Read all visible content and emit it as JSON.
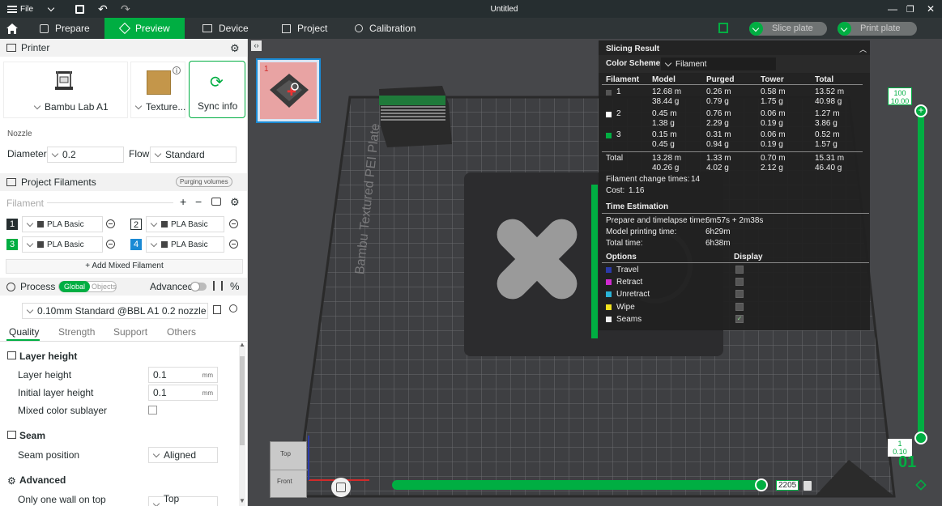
{
  "titlebar": {
    "file_menu": "File",
    "title": "Untitled"
  },
  "nav": {
    "tabs": [
      "Prepare",
      "Preview",
      "Device",
      "Project",
      "Calibration"
    ],
    "slice_plate": "Slice plate",
    "print_plate": "Print plate"
  },
  "printer": {
    "section_title": "Printer",
    "printer_name": "Bambu Lab A1",
    "plate_label": "Texture...",
    "sync_info": "Sync info",
    "nozzle_label": "Nozzle",
    "diameter_label": "Diameter",
    "diameter_value": "0.2",
    "flow_label": "Flow",
    "flow_value": "Standard"
  },
  "filaments": {
    "section_title": "Project Filaments",
    "purging_volumes": "Purging volumes",
    "filament_label": "Filament",
    "add_mixed": "+ Add Mixed Filament",
    "items": [
      {
        "num": "1",
        "name": "PLA Basic",
        "color": "#262e30"
      },
      {
        "num": "2",
        "name": "PLA Basic",
        "color": "#ffffff"
      },
      {
        "num": "3",
        "name": "PLA Basic",
        "color": "#00ae42"
      },
      {
        "num": "4",
        "name": "PLA Basic",
        "color": "#1a8ad4"
      }
    ]
  },
  "process": {
    "section_title": "Process",
    "global": "Global",
    "objects": "Objects",
    "advanced": "Advanced",
    "preset": "0.10mm Standard @BBL A1 0.2 nozzle",
    "tabs": [
      "Quality",
      "Strength",
      "Support",
      "Others"
    ],
    "layer_height_group": "Layer height",
    "layer_height_label": "Layer height",
    "layer_height_value": "0.1",
    "layer_height_unit": "mm",
    "initial_layer_label": "Initial layer height",
    "initial_layer_value": "0.1",
    "initial_layer_unit": "mm",
    "mixed_color_label": "Mixed color sublayer",
    "seam_group": "Seam",
    "seam_position_label": "Seam position",
    "seam_position_value": "Aligned",
    "advanced_group": "Advanced",
    "one_wall_label": "Only one wall on top",
    "one_wall_value": "Top surfaces"
  },
  "plate_thumb": {
    "number": "1"
  },
  "bed": {
    "text": "Bambu Textured PEI Plate"
  },
  "cube": {
    "top": "Top",
    "front": "Front"
  },
  "sliders": {
    "top_value_1": "100",
    "top_value_2": "10.00",
    "bottom_value_1": "1",
    "bottom_value_2": "0.10",
    "layer_big": "01",
    "horizontal_value": "2205"
  },
  "slicing_result": {
    "title": "Slicing Result",
    "color_scheme_label": "Color Scheme",
    "color_scheme_value": "Filament",
    "headers": [
      "Filament",
      "Model",
      "Purged",
      "Tower",
      "Total"
    ],
    "rows": [
      {
        "id": "1",
        "color": "#262e30",
        "model_m": "12.68 m",
        "model_g": "38.44 g",
        "purged_m": "0.26 m",
        "purged_g": "0.79 g",
        "tower_m": "0.58 m",
        "tower_g": "1.75 g",
        "total_m": "13.52 m",
        "total_g": "40.98 g"
      },
      {
        "id": "2",
        "color": "#ffffff",
        "model_m": "0.45 m",
        "model_g": "1.38 g",
        "purged_m": "0.76 m",
        "purged_g": "2.29 g",
        "tower_m": "0.06 m",
        "tower_g": "0.19 g",
        "total_m": "1.27 m",
        "total_g": "3.86 g"
      },
      {
        "id": "3",
        "color": "#00ae42",
        "model_m": "0.15 m",
        "model_g": "0.45 g",
        "purged_m": "0.31 m",
        "purged_g": "0.94 g",
        "tower_m": "0.06 m",
        "tower_g": "0.19 g",
        "total_m": "0.52 m",
        "total_g": "1.57 g"
      }
    ],
    "total": {
      "label": "Total",
      "model_m": "13.28 m",
      "model_g": "40.26 g",
      "purged_m": "1.33 m",
      "purged_g": "4.02 g",
      "tower_m": "0.70 m",
      "tower_g": "2.12 g",
      "total_m": "15.31 m",
      "total_g": "46.40 g"
    },
    "change_times_label": "Filament change times:",
    "change_times_value": "14",
    "cost_label": "Cost:",
    "cost_value": "1.16",
    "time_title": "Time Estimation",
    "prepare_label": "Prepare and timelapse time:",
    "prepare_value": "6m57s + 2m38s",
    "model_time_label": "Model printing time:",
    "model_time_value": "6h29m",
    "total_time_label": "Total time:",
    "total_time_value": "6h38m",
    "options_label": "Options",
    "display_label": "Display",
    "options": [
      {
        "name": "Travel",
        "color": "#2b3aa8"
      },
      {
        "name": "Retract",
        "color": "#d12ad1"
      },
      {
        "name": "Unretract",
        "color": "#2ab3d6"
      },
      {
        "name": "Wipe",
        "color": "#f2e21f"
      },
      {
        "name": "Seams",
        "color": "#f0f0f0"
      }
    ]
  }
}
